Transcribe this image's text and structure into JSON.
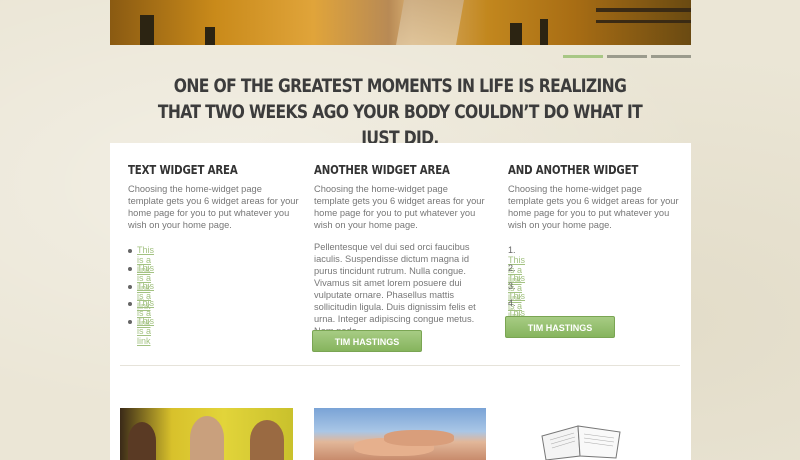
{
  "tagline": "One of the greatest moments in life is realizing that two weeks ago your body couldn’t do what it just did.",
  "slider": {
    "dots": 3,
    "active_index": 0
  },
  "widgets": [
    {
      "title": "Text Widget Area",
      "body": "Choosing the home-widget page template gets you 6 widget areas for your home page for you to put whatever you wish on your home page.",
      "links": [
        "This is a link",
        "This is a link",
        "This is a link",
        "This is a link",
        "This is a link"
      ]
    },
    {
      "title": "Another Widget Area",
      "body": "Choosing the home-widget page template gets you 6 widget areas for your home page for you to put whatever you wish on your home page.",
      "body2": "Pellentesque vel dui sed orci faucibus iaculis. Suspendisse dictum magna id purus tincidunt rutrum. Nulla congue. Vivamus sit amet lorem posuere dui vulputate ornare. Phasellus mattis sollicitudin ligula. Duis dignissim felis et urna. Integer adipiscing congue metus. Nam pede.",
      "button": "Tim Hastings"
    },
    {
      "title": "And Another Widget",
      "body": "Choosing the home-widget page template gets you 6 widget areas for your home page for you to put whatever you wish on your home page.",
      "ordered_links": [
        {
          "num": "1.",
          "label": "This is a link"
        },
        {
          "num": "2.",
          "label": "This is a link"
        },
        {
          "num": "3.",
          "label": "This is a link"
        },
        {
          "num": "4.",
          "label": "This is a link"
        }
      ],
      "button": "Tim Hastings"
    }
  ],
  "colors": {
    "accent": "#8bb863",
    "link": "#a3c282",
    "panel": "#ffffff",
    "background": "#ebe6d6"
  },
  "icons": [
    "open-book-icon"
  ]
}
